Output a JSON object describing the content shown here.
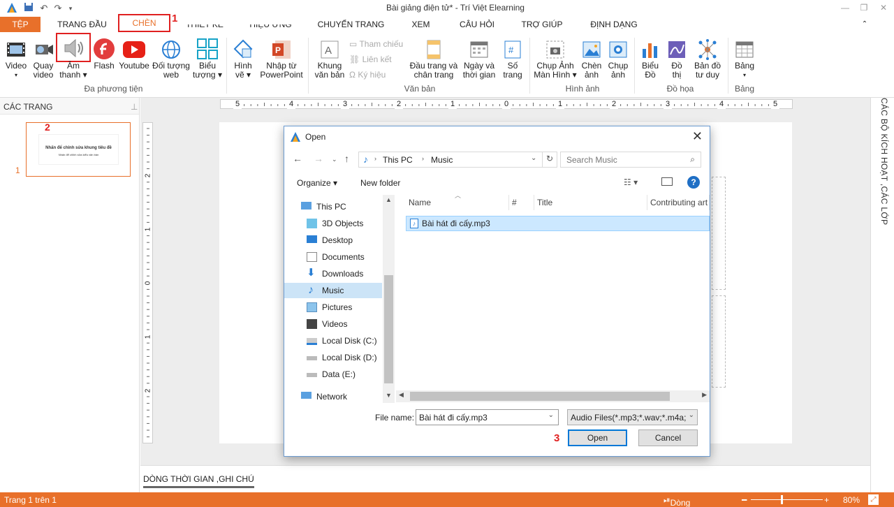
{
  "window": {
    "title": "Bài giảng điện tử* - Trí Việt Elearning"
  },
  "tabs": [
    {
      "label": "TỆP"
    },
    {
      "label": "TRANG ĐẦU"
    },
    {
      "label": "CHÈN"
    },
    {
      "label": "THIẾT KẾ"
    },
    {
      "label": "HIỆU ỨNG"
    },
    {
      "label": "CHUYỂN TRANG"
    },
    {
      "label": "XEM"
    },
    {
      "label": "CÂU HỎI"
    },
    {
      "label": "TRỢ GIÚP"
    },
    {
      "label": "ĐỊNH DẠNG"
    }
  ],
  "annotations": {
    "one": "1",
    "two": "2",
    "three": "3"
  },
  "ribbon": {
    "video": "Video",
    "quay_video_1": "Quay",
    "quay_video_2": "video",
    "am_thanh_1": "Âm",
    "am_thanh_2": "thanh",
    "flash": "Flash",
    "youtube": "Youtube",
    "doi_tuong_1": "Đối tượng",
    "doi_tuong_2": "web",
    "bieu_tuong_1": "Biểu",
    "bieu_tuong_2": "tượng",
    "group_media": "Đa phương tiện",
    "hinh_ve_1": "Hình",
    "hinh_ve_2": "vẽ",
    "nhap_ppt_1": "Nhập từ",
    "nhap_ppt_2": "PowerPoint",
    "khung_1": "Khung",
    "khung_2": "văn bản",
    "tham_chieu": "Tham chiếu",
    "lien_ket": "Liên kết",
    "ky_hieu": "Ký hiệu",
    "dau_trang_1": "Đầu trang và",
    "dau_trang_2": "chân trang",
    "ngay_1": "Ngày và",
    "ngay_2": "thời gian",
    "so_trang_1": "Số",
    "so_trang_2": "trang",
    "group_vanban": "Văn bản",
    "chup_mh_1": "Chụp Ảnh",
    "chup_mh_2": "Màn Hình",
    "chen_anh_1": "Chèn",
    "chen_anh_2": "ảnh",
    "chup_anh_1": "Chụp",
    "chup_anh_2": "ảnh",
    "group_hinhanh": "Hình ảnh",
    "bieu_do_1": "Biểu",
    "bieu_do_2": "Đồ",
    "do_thi_1": "Đồ",
    "do_thi_2": "thị",
    "ban_do_1": "Bản đồ",
    "ban_do_2": "tư duy",
    "group_dohoa": "Đồ họa",
    "bang": "Bảng",
    "group_bang": "Bảng"
  },
  "left_panel": {
    "header": "CÁC TRANG",
    "slide_number": "1",
    "slide_text_1": "Nhấn để chỉnh sửa khung tiêu đề",
    "slide_text_2": "Nhấn để chỉnh sửa kiểu văn bản"
  },
  "ruler": {
    "h": [
      "5",
      "4",
      "3",
      "2",
      "1",
      "0",
      "1",
      "2",
      "3",
      "4",
      "5"
    ],
    "v": [
      "2",
      "1",
      "0",
      "1",
      "2"
    ]
  },
  "right_side": {
    "label": "CÁC BỘ KÍCH HOẠT ,CÁC LỚP"
  },
  "timeline": {
    "label": "DÒNG THỜI GIAN ,GHI CHÚ"
  },
  "status": {
    "page": "Trang 1 trên 1",
    "timeline_btn": "Dòng Thời Gian",
    "zoom": "80%"
  },
  "dialog": {
    "title": "Open",
    "path": [
      "This PC",
      "Music"
    ],
    "search_placeholder": "Search Music",
    "organize": "Organize",
    "new_folder": "New folder",
    "nav_items": [
      {
        "label": "This PC"
      },
      {
        "label": "3D Objects"
      },
      {
        "label": "Desktop"
      },
      {
        "label": "Documents"
      },
      {
        "label": "Downloads"
      },
      {
        "label": "Music"
      },
      {
        "label": "Pictures"
      },
      {
        "label": "Videos"
      },
      {
        "label": "Local Disk (C:)"
      },
      {
        "label": "Local Disk (D:)"
      },
      {
        "label": "Data (E:)"
      },
      {
        "label": "Network"
      }
    ],
    "columns": {
      "name": "Name",
      "num": "#",
      "title": "Title",
      "contrib": "Contributing art"
    },
    "file": "Bài hát đi cấy.mp3",
    "file_name_label": "File name:",
    "file_name_value": "Bài hát đi cấy.mp3",
    "filter": "Audio Files(*.mp3;*.wav;*.m4a;",
    "open_btn": "Open",
    "cancel_btn": "Cancel"
  }
}
